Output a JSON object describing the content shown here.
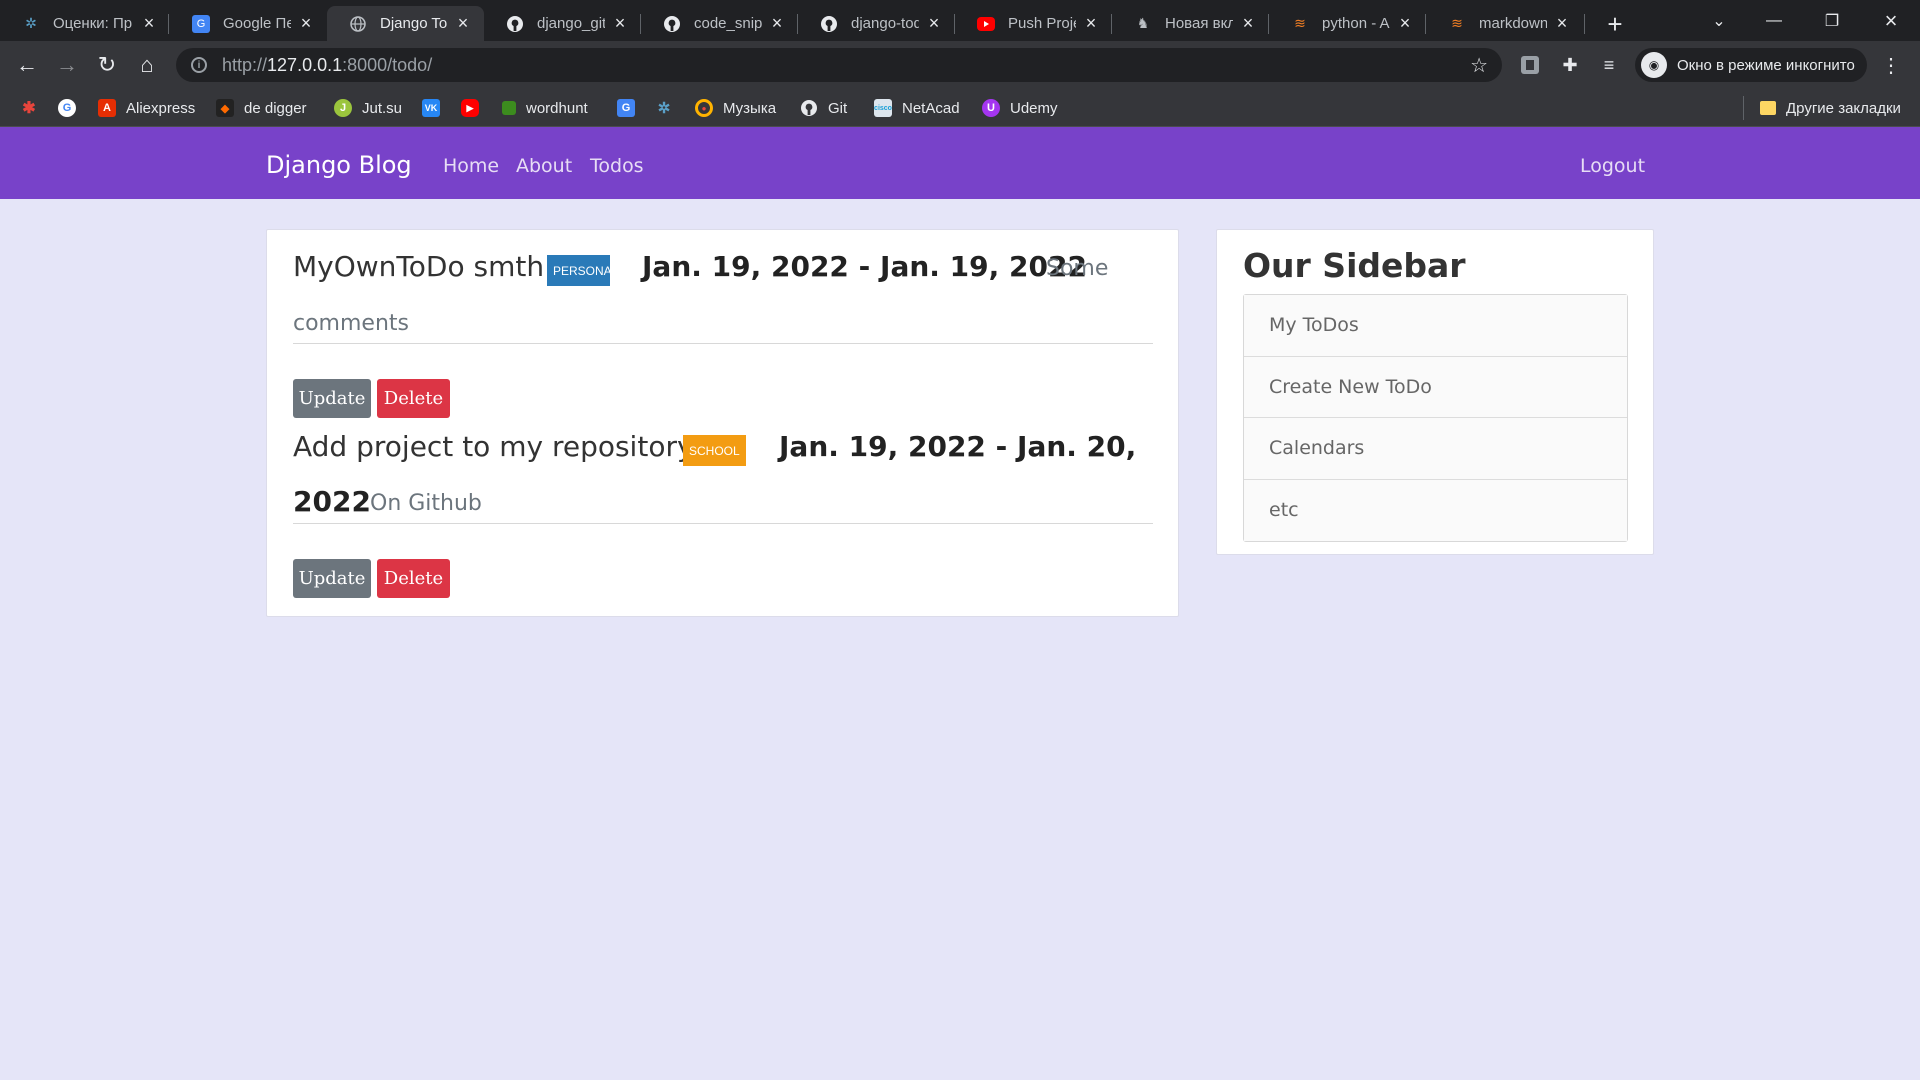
{
  "browser": {
    "tabs": [
      {
        "label": "Оценки: Пр",
        "icon": "puzzle-logo-icon",
        "active": false
      },
      {
        "label": "Google Пер",
        "icon": "google-translate-icon",
        "active": false
      },
      {
        "label": "Django ToD",
        "icon": "globe-icon",
        "active": true
      },
      {
        "label": "django_git_",
        "icon": "github-icon",
        "active": false
      },
      {
        "label": "code_snipp",
        "icon": "github-icon",
        "active": false
      },
      {
        "label": "django-tod",
        "icon": "github-icon",
        "active": false
      },
      {
        "label": "Push Projec",
        "icon": "youtube-icon",
        "active": false
      },
      {
        "label": "Новая вкла",
        "icon": "incognito-icon",
        "active": false
      },
      {
        "label": "python - Ac",
        "icon": "stackoverflow-icon",
        "active": false
      },
      {
        "label": "markdown",
        "icon": "stackoverflow-icon",
        "active": false
      }
    ],
    "url": {
      "scheme": "http://",
      "host": "127.0.0.1",
      "rest": ":8000/todo/"
    },
    "incognito_label": "Окно в режиме инкогнито",
    "bookmarks": [
      {
        "label": "",
        "icon": "colorful-app-icon",
        "color": "#e8453c"
      },
      {
        "label": "",
        "icon": "google-icon",
        "color": "#ffffff"
      },
      {
        "label": "Aliexpress",
        "icon": "aliexpress-icon",
        "color": "#e62e04"
      },
      {
        "label": "de digger",
        "icon": "de-digger-icon",
        "color": "#222222"
      },
      {
        "label": "Jut.su",
        "icon": "jutsu-icon",
        "color": "#9bc53d"
      },
      {
        "label": "",
        "icon": "vk-icon",
        "color": "#2787f5"
      },
      {
        "label": "",
        "icon": "youtube-icon",
        "color": "#ff0000"
      },
      {
        "label": "wordhunt",
        "icon": "wordhunt-icon",
        "color": "#3c8c1e"
      },
      {
        "label": "",
        "icon": "google-translate-icon",
        "color": "#4285f4"
      },
      {
        "label": "",
        "icon": "puzzle-logo-icon",
        "color": "#3b4a5a"
      },
      {
        "label": "Музыка",
        "icon": "music-icon",
        "color": "#ffb300"
      },
      {
        "label": "Git",
        "icon": "github-icon",
        "color": "#35363a"
      },
      {
        "label": "NetAcad",
        "icon": "cisco-icon",
        "color": "#dde6ee"
      },
      {
        "label": "Udemy",
        "icon": "udemy-icon",
        "color": "#a435f0"
      }
    ],
    "other_bookmarks": "Другие закладки"
  },
  "site": {
    "brand": "Django Blog",
    "nav": [
      "Home",
      "About",
      "Todos"
    ],
    "logout": "Logout",
    "accent": "#7842c9"
  },
  "todos": [
    {
      "title": "MyOwnToDo smth",
      "category": "PERSONAL",
      "category_color": "#2a7ab8",
      "dates": "Jan. 19, 2022 - Jan. 19, 2022",
      "comment_a": "Some",
      "comment_b": "comments",
      "update": "Update",
      "delete": "Delete"
    },
    {
      "title": "Add project to my repository",
      "category": "SCHOOL",
      "category_color": "#f39c12",
      "dates_a": "Jan. 19, 2022 - Jan. 20,",
      "dates_b": "2022",
      "comment": "On Github",
      "update": "Update",
      "delete": "Delete"
    }
  ],
  "sidebar": {
    "title": "Our Sidebar",
    "items": [
      "My ToDos",
      "Create New ToDo",
      "Calendars",
      "etc"
    ]
  }
}
